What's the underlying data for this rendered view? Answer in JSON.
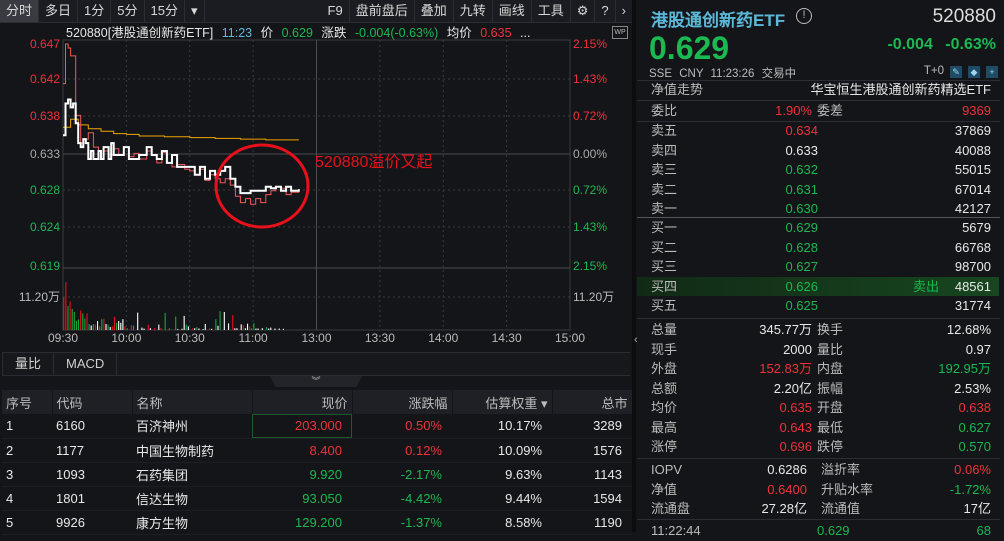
{
  "toolbar": {
    "tabs": [
      "分时",
      "多日",
      "1分",
      "5分",
      "15分"
    ],
    "more": "▾",
    "right": [
      "F9",
      "盘前盘后",
      "叠加",
      "九转",
      "画线",
      "工具"
    ],
    "active": 0
  },
  "chart_head": {
    "code_name": "520880[港股通创新药ETF]",
    "time": "11:23",
    "price_label": "价",
    "price": "0.629",
    "change_label": "涨跌",
    "change": "-0.004(-0.63%)",
    "avg_label": "均价",
    "avg": "0.635",
    "more": "...",
    "wp": "WP"
  },
  "colors": {
    "up": "#f0313a",
    "down": "#1cb851",
    "price_line": "#ffffff",
    "iopv_line": "#f05a5a",
    "avg_line": "#f0a500",
    "accent": "#5bb8d8"
  },
  "chart_data": {
    "type": "line",
    "ylim": [
      0.619,
      0.647
    ],
    "left_ticks": [
      "0.647",
      "0.642",
      "0.638",
      "0.633",
      "0.628",
      "0.624",
      "0.619"
    ],
    "right_ticks": [
      "2.15%",
      "1.43%",
      "0.72%",
      "0.00%",
      "0.72%",
      "1.43%",
      "2.15%"
    ],
    "volume_tick": "11.20万",
    "x_ticks": [
      "09:30",
      "10:00",
      "10:30",
      "11:00",
      "13:00",
      "13:30",
      "14:00",
      "14:30",
      "15:00"
    ],
    "x_unit": "minutes since 09:30 (0-240)",
    "series": [
      {
        "name": "价格",
        "points": [
          [
            0,
            0.6355
          ],
          [
            1,
            0.6395
          ],
          [
            2,
            0.64
          ],
          [
            3,
            0.639
          ],
          [
            4,
            0.6395
          ],
          [
            5,
            0.637
          ],
          [
            6,
            0.6345
          ],
          [
            7,
            0.634
          ],
          [
            8,
            0.635
          ],
          [
            9,
            0.6345
          ],
          [
            10,
            0.6325
          ],
          [
            11,
            0.6335
          ],
          [
            12,
            0.6325
          ],
          [
            14,
            0.6335
          ],
          [
            15,
            0.6325
          ],
          [
            16,
            0.634
          ],
          [
            18,
            0.6325
          ],
          [
            19,
            0.6345
          ],
          [
            20,
            0.633
          ],
          [
            22,
            0.633
          ],
          [
            24,
            0.634
          ],
          [
            26,
            0.6325
          ],
          [
            28,
            0.6325
          ],
          [
            30,
            0.633
          ],
          [
            33,
            0.634
          ],
          [
            35,
            0.633
          ],
          [
            37,
            0.6325
          ],
          [
            39,
            0.6335
          ],
          [
            41,
            0.632
          ],
          [
            43,
            0.633
          ],
          [
            45,
            0.6315
          ],
          [
            48,
            0.6315
          ],
          [
            50,
            0.6315
          ],
          [
            52,
            0.6305
          ],
          [
            54,
            0.6315
          ],
          [
            56,
            0.63
          ],
          [
            58,
            0.631
          ],
          [
            60,
            0.6305
          ],
          [
            62,
            0.631
          ],
          [
            64,
            0.6315
          ],
          [
            66,
            0.63
          ],
          [
            68,
            0.629
          ],
          [
            70,
            0.6282
          ],
          [
            72,
            0.6282
          ],
          [
            74,
            0.6285
          ],
          [
            78,
            0.6285
          ],
          [
            80,
            0.629
          ],
          [
            82,
            0.6288
          ],
          [
            84,
            0.629
          ],
          [
            86,
            0.6285
          ],
          [
            88,
            0.629
          ],
          [
            90,
            0.6285
          ],
          [
            93,
            0.6287
          ]
        ]
      },
      {
        "name": "IOPV",
        "points": [
          [
            0,
            0.642
          ],
          [
            1,
            0.647
          ],
          [
            2,
            0.6465
          ],
          [
            3,
            0.6455
          ],
          [
            5,
            0.638
          ],
          [
            7,
            0.6345
          ],
          [
            9,
            0.635
          ],
          [
            10,
            0.6358
          ],
          [
            12,
            0.634
          ],
          [
            14,
            0.6325
          ],
          [
            16,
            0.6335
          ],
          [
            18,
            0.633
          ],
          [
            20,
            0.6338
          ],
          [
            22,
            0.633
          ],
          [
            24,
            0.634
          ],
          [
            26,
            0.6328
          ],
          [
            28,
            0.6332
          ],
          [
            30,
            0.6325
          ],
          [
            33,
            0.6335
          ],
          [
            35,
            0.633
          ],
          [
            37,
            0.632
          ],
          [
            39,
            0.6333
          ],
          [
            41,
            0.632
          ],
          [
            43,
            0.6315
          ],
          [
            45,
            0.6318
          ],
          [
            48,
            0.6312
          ],
          [
            50,
            0.631
          ],
          [
            52,
            0.6305
          ],
          [
            54,
            0.6312
          ],
          [
            56,
            0.6298
          ],
          [
            58,
            0.6305
          ],
          [
            60,
            0.63
          ],
          [
            62,
            0.6295
          ],
          [
            64,
            0.63
          ],
          [
            66,
            0.6292
          ],
          [
            68,
            0.6278
          ],
          [
            70,
            0.627
          ],
          [
            72,
            0.6275
          ],
          [
            74,
            0.6268
          ],
          [
            76,
            0.6275
          ],
          [
            78,
            0.627
          ],
          [
            80,
            0.628
          ],
          [
            82,
            0.6285
          ],
          [
            84,
            0.629
          ],
          [
            86,
            0.6288
          ],
          [
            88,
            0.628
          ],
          [
            90,
            0.6283
          ],
          [
            93,
            0.6286
          ]
        ]
      },
      {
        "name": "均价",
        "points": [
          [
            0,
            0.6365
          ],
          [
            3,
            0.6375
          ],
          [
            6,
            0.6368
          ],
          [
            10,
            0.6363
          ],
          [
            15,
            0.636
          ],
          [
            20,
            0.6357
          ],
          [
            25,
            0.6356
          ],
          [
            30,
            0.6354
          ],
          [
            40,
            0.6353
          ],
          [
            50,
            0.6352
          ],
          [
            60,
            0.6351
          ],
          [
            70,
            0.635
          ],
          [
            80,
            0.6349
          ],
          [
            93,
            0.6349
          ]
        ]
      }
    ],
    "volume": [
      {
        "m": 0,
        "v": 11,
        "c": "up"
      },
      {
        "m": 1,
        "v": 16,
        "c": "up"
      },
      {
        "m": 2,
        "v": 8,
        "c": "down"
      },
      {
        "m": 3,
        "v": 9.5,
        "c": "up"
      },
      {
        "m": 4,
        "v": 7,
        "c": "down"
      },
      {
        "m": 5,
        "v": 6,
        "c": "down"
      },
      {
        "m": 6,
        "v": 3,
        "c": "down"
      },
      {
        "m": 7,
        "v": 3.5,
        "c": "down"
      },
      {
        "m": 8,
        "v": 6.5,
        "c": "up"
      },
      {
        "m": 9,
        "v": 5.5,
        "c": "down"
      },
      {
        "m": 10,
        "v": 3.8,
        "c": "down"
      },
      {
        "m": 11,
        "v": 5.5,
        "c": "up"
      },
      {
        "m": 12,
        "v": 2,
        "c": "down"
      },
      {
        "m": 13,
        "v": 1.5,
        "c": "flat"
      },
      {
        "m": 14,
        "v": 2,
        "c": "down"
      },
      {
        "m": 15,
        "v": 1.8,
        "c": "up"
      },
      {
        "m": 16,
        "v": 3,
        "c": "flat"
      },
      {
        "m": 17,
        "v": 1.2,
        "c": "down"
      },
      {
        "m": 18,
        "v": 3.6,
        "c": "down"
      },
      {
        "m": 19,
        "v": 3.8,
        "c": "up"
      },
      {
        "m": 20,
        "v": 2,
        "c": "flat"
      },
      {
        "m": 21,
        "v": 1.8,
        "c": "down"
      },
      {
        "m": 22,
        "v": 1,
        "c": "flat"
      },
      {
        "m": 23,
        "v": 1.2,
        "c": "up"
      },
      {
        "m": 24,
        "v": 4.4,
        "c": "up"
      },
      {
        "m": 25,
        "v": 2.4,
        "c": "down"
      },
      {
        "m": 26,
        "v": 3,
        "c": "flat"
      },
      {
        "m": 27,
        "v": 2.4,
        "c": "flat"
      },
      {
        "m": 28,
        "v": 3.6,
        "c": "flat"
      },
      {
        "m": 29,
        "v": 1.2,
        "c": "up"
      },
      {
        "m": 30,
        "v": 0.6,
        "c": "down"
      },
      {
        "m": 32,
        "v": 1.6,
        "c": "up"
      },
      {
        "m": 33,
        "v": 1.5,
        "c": "down"
      },
      {
        "m": 35,
        "v": 5.8,
        "c": "flat"
      },
      {
        "m": 37,
        "v": 0.8,
        "c": "flat"
      },
      {
        "m": 38,
        "v": 0.5,
        "c": "flat"
      },
      {
        "m": 40,
        "v": 1.8,
        "c": "up"
      },
      {
        "m": 41,
        "v": 0.6,
        "c": "flat"
      },
      {
        "m": 43,
        "v": 0.6,
        "c": "up"
      },
      {
        "m": 45,
        "v": 1.8,
        "c": "flat"
      },
      {
        "m": 46,
        "v": 0.7,
        "c": "up"
      },
      {
        "m": 48,
        "v": 5.7,
        "c": "down"
      },
      {
        "m": 50,
        "v": 0.6,
        "c": "down"
      },
      {
        "m": 53,
        "v": 4.5,
        "c": "down"
      },
      {
        "m": 54,
        "v": 0.3,
        "c": "flat"
      },
      {
        "m": 56,
        "v": 0.4,
        "c": "flat"
      },
      {
        "m": 57,
        "v": 4.7,
        "c": "flat"
      },
      {
        "m": 58,
        "v": 1.8,
        "c": "down"
      },
      {
        "m": 59,
        "v": 1.2,
        "c": "flat"
      },
      {
        "m": 61,
        "v": 0.5,
        "c": "up"
      },
      {
        "m": 62,
        "v": 0.6,
        "c": "flat"
      },
      {
        "m": 63,
        "v": 1,
        "c": "down"
      },
      {
        "m": 64,
        "v": 0.5,
        "c": "flat"
      },
      {
        "m": 66,
        "v": 0.3,
        "c": "flat"
      },
      {
        "m": 67,
        "v": 2,
        "c": "flat"
      },
      {
        "m": 69,
        "v": 0.5,
        "c": "up"
      },
      {
        "m": 70,
        "v": 0.4,
        "c": "flat"
      },
      {
        "m": 72,
        "v": 3.6,
        "c": "down"
      },
      {
        "m": 73,
        "v": 1.4,
        "c": "flat"
      },
      {
        "m": 74,
        "v": 6.3,
        "c": "down"
      },
      {
        "m": 76,
        "v": 6,
        "c": "flat"
      },
      {
        "m": 78,
        "v": 2.2,
        "c": "flat"
      },
      {
        "m": 80,
        "v": 5,
        "c": "up"
      },
      {
        "m": 81,
        "v": 0.6,
        "c": "flat"
      },
      {
        "m": 82,
        "v": 0.6,
        "c": "flat"
      },
      {
        "m": 84,
        "v": 1.9,
        "c": "flat"
      },
      {
        "m": 85,
        "v": 1.5,
        "c": "up"
      },
      {
        "m": 86,
        "v": 0.6,
        "c": "flat"
      },
      {
        "m": 87,
        "v": 2.1,
        "c": "flat"
      },
      {
        "m": 88,
        "v": 1.2,
        "c": "up"
      },
      {
        "m": 89,
        "v": 0.6,
        "c": "down"
      },
      {
        "m": 90,
        "v": 2.3,
        "c": "down"
      },
      {
        "m": 91,
        "v": 0.5,
        "c": "flat"
      },
      {
        "m": 92,
        "v": 0.5,
        "c": "flat"
      },
      {
        "m": 94,
        "v": 0.6,
        "c": "flat"
      },
      {
        "m": 96,
        "v": 1,
        "c": "down"
      },
      {
        "m": 97,
        "v": 0.5,
        "c": "flat"
      },
      {
        "m": 98,
        "v": 0.8,
        "c": "flat"
      },
      {
        "m": 100,
        "v": 0.5,
        "c": "flat"
      },
      {
        "m": 102,
        "v": 0.5,
        "c": "flat"
      },
      {
        "m": 104,
        "v": 0.4,
        "c": "flat"
      }
    ],
    "volume_max": 20,
    "annotation": "520880溢价又起"
  },
  "subtabs": [
    "量比",
    "MACD"
  ],
  "expander": "︾",
  "table": {
    "headers": [
      "序号",
      "代码",
      "名称",
      "现价",
      "涨跌幅",
      "估算权重 ▾",
      "总市"
    ],
    "rows": [
      {
        "no": "1",
        "code": "6160",
        "name": "百济神州",
        "price": "203.000",
        "chg": "0.50%",
        "weight": "10.17%",
        "cap": "3289",
        "dir": "red"
      },
      {
        "no": "2",
        "code": "1177",
        "name": "中国生物制药",
        "price": "8.400",
        "chg": "0.12%",
        "weight": "10.09%",
        "cap": "1576",
        "dir": "red"
      },
      {
        "no": "3",
        "code": "1093",
        "name": "石药集团",
        "price": "9.920",
        "chg": "-2.17%",
        "weight": "9.63%",
        "cap": "1143",
        "dir": "green"
      },
      {
        "no": "4",
        "code": "1801",
        "name": "信达生物",
        "price": "93.050",
        "chg": "-4.42%",
        "weight": "9.44%",
        "cap": "1594",
        "dir": "green"
      },
      {
        "no": "5",
        "code": "9926",
        "name": "康方生物",
        "price": "129.200",
        "chg": "-1.37%",
        "weight": "8.58%",
        "cap": "1190",
        "dir": "green"
      }
    ]
  },
  "quote": {
    "name": "港股通创新药ETF",
    "info": "!",
    "code": "520880",
    "price": "0.629",
    "change": "-0.004",
    "change_pct": "-0.63%",
    "exchange": "SSE",
    "currency": "CNY",
    "time": "11:23:26",
    "status": "交易中",
    "t0": "T+0",
    "nav_trend": "净值走势",
    "index_name": "华宝恒生港股通创新药精选ETF",
    "webi_label": "委比",
    "webi": "1.90%",
    "weicha_label": "委差",
    "weicha": "9369",
    "asks": [
      {
        "label": "卖五",
        "price": "0.634",
        "vol": "37869",
        "c": "red"
      },
      {
        "label": "卖四",
        "price": "0.633",
        "vol": "40088",
        "c": "white"
      },
      {
        "label": "卖三",
        "price": "0.632",
        "vol": "55015",
        "c": "green"
      },
      {
        "label": "卖二",
        "price": "0.631",
        "vol": "67014",
        "c": "green"
      },
      {
        "label": "卖一",
        "price": "0.630",
        "vol": "42127",
        "c": "green"
      }
    ],
    "bids": [
      {
        "label": "买一",
        "price": "0.629",
        "vol": "5679",
        "c": "green"
      },
      {
        "label": "买二",
        "price": "0.628",
        "vol": "66768",
        "c": "green"
      },
      {
        "label": "买三",
        "price": "0.627",
        "vol": "98700",
        "c": "green"
      },
      {
        "label": "买四",
        "price": "0.626",
        "vol": "48561",
        "c": "green",
        "tag": "卖出"
      },
      {
        "label": "买五",
        "price": "0.625",
        "vol": "31774",
        "c": "green"
      }
    ],
    "stats": [
      [
        "总量",
        "345.77万",
        "white",
        "换手",
        "12.68%",
        "white"
      ],
      [
        "现手",
        "2000",
        "white",
        "量比",
        "0.97",
        "white"
      ],
      [
        "外盘",
        "152.83万",
        "red",
        "内盘",
        "192.95万",
        "green"
      ],
      [
        "总额",
        "2.20亿",
        "white",
        "振幅",
        "2.53%",
        "white"
      ],
      [
        "均价",
        "0.635",
        "red",
        "开盘",
        "0.638",
        "red"
      ],
      [
        "最高",
        "0.643",
        "red",
        "最低",
        "0.627",
        "green"
      ],
      [
        "涨停",
        "0.696",
        "red",
        "跌停",
        "0.570",
        "green"
      ]
    ],
    "etf": [
      [
        "IOPV",
        "0.6286",
        "white",
        "溢折率",
        "0.06%",
        "red"
      ],
      [
        "净值",
        "0.6400",
        "red",
        "升贴水率",
        "-1.72%",
        "green"
      ],
      [
        "流通盘",
        "27.28亿",
        "white",
        "流通值",
        "17亿",
        "white"
      ]
    ],
    "tick": {
      "time": "11:22:44",
      "price": "0.629",
      "vol": "68"
    }
  }
}
